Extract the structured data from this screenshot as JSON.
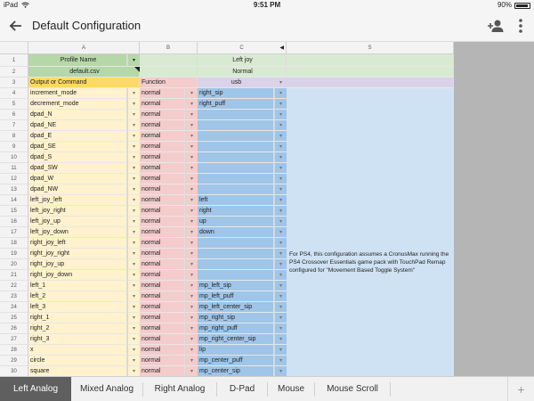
{
  "status_bar": {
    "device": "iPad",
    "time": "9:51 PM",
    "battery": "90%",
    "battery_level": 0.9
  },
  "app_bar": {
    "title": "Default Configuration"
  },
  "columns": [
    {
      "letter": "A"
    },
    {
      "letter": "B"
    },
    {
      "letter": "C",
      "arrow": "◀"
    },
    {
      "letter": "S"
    }
  ],
  "header_rows": {
    "r1": {
      "num": "1",
      "a": "Profile Name",
      "c": "Left joy"
    },
    "r2": {
      "num": "2",
      "a": "default.csv",
      "c": "Normal"
    },
    "r3": {
      "num": "3",
      "a": "Output or Command",
      "b": "Function",
      "c": "usb"
    }
  },
  "rows": [
    {
      "num": "4",
      "a": "increment_mode",
      "b": "normal",
      "c": "right_sip"
    },
    {
      "num": "5",
      "a": "decrement_mode",
      "b": "normal",
      "c": "right_puff"
    },
    {
      "num": "6",
      "a": "dpad_N",
      "b": "normal",
      "c": ""
    },
    {
      "num": "7",
      "a": "dpad_NE",
      "b": "normal",
      "c": ""
    },
    {
      "num": "8",
      "a": "dpad_E",
      "b": "normal",
      "c": ""
    },
    {
      "num": "9",
      "a": "dpad_SE",
      "b": "normal",
      "c": ""
    },
    {
      "num": "10",
      "a": "dpad_S",
      "b": "normal",
      "c": ""
    },
    {
      "num": "11",
      "a": "dpad_SW",
      "b": "normal",
      "c": ""
    },
    {
      "num": "12",
      "a": "dpad_W",
      "b": "normal",
      "c": ""
    },
    {
      "num": "13",
      "a": "dpad_NW",
      "b": "normal",
      "c": ""
    },
    {
      "num": "14",
      "a": "left_joy_left",
      "b": "normal",
      "c": "left"
    },
    {
      "num": "15",
      "a": "left_joy_right",
      "b": "normal",
      "c": "right"
    },
    {
      "num": "16",
      "a": "left_joy_up",
      "b": "normal",
      "c": "up"
    },
    {
      "num": "17",
      "a": "left_joy_down",
      "b": "normal",
      "c": "down"
    },
    {
      "num": "18",
      "a": "right_joy_left",
      "b": "normal",
      "c": ""
    },
    {
      "num": "19",
      "a": "right_joy_right",
      "b": "normal",
      "c": ""
    },
    {
      "num": "20",
      "a": "right_joy_up",
      "b": "normal",
      "c": ""
    },
    {
      "num": "21",
      "a": "right_joy_down",
      "b": "normal",
      "c": ""
    },
    {
      "num": "22",
      "a": "left_1",
      "b": "normal",
      "c": "mp_left_sip"
    },
    {
      "num": "23",
      "a": "left_2",
      "b": "normal",
      "c": "mp_left_puff"
    },
    {
      "num": "24",
      "a": "left_3",
      "b": "normal",
      "c": "mp_left_center_sip"
    },
    {
      "num": "25",
      "a": "right_1",
      "b": "normal",
      "c": "mp_right_sip"
    },
    {
      "num": "26",
      "a": "right_2",
      "b": "normal",
      "c": "mp_right_puff"
    },
    {
      "num": "27",
      "a": "right_3",
      "b": "normal",
      "c": "mp_right_center_sip"
    },
    {
      "num": "28",
      "a": "x",
      "b": "normal",
      "c": "lip"
    },
    {
      "num": "29",
      "a": "circle",
      "b": "normal",
      "c": "mp_center_puff"
    },
    {
      "num": "30",
      "a": "square",
      "b": "normal",
      "c": "mp_center_sip"
    }
  ],
  "note": "For PS4, this configuration assumes a CronusMax running the PS4 Crossover Essentials game pack with TouchPad Remap configured for \"Movement Based Toggle System\"",
  "tabs": [
    {
      "label": "Left Analog",
      "active": true
    },
    {
      "label": "Mixed Analog",
      "active": false
    },
    {
      "label": "Right Analog",
      "active": false
    },
    {
      "label": "D-Pad",
      "active": false
    },
    {
      "label": "Mouse",
      "active": false
    },
    {
      "label": "Mouse Scroll",
      "active": false
    }
  ],
  "add_sheet_label": "+",
  "icons": {
    "back": "arrow-back-icon",
    "add_user": "add-user-icon",
    "more": "more-vertical-icon",
    "dropdown": "dropdown-arrow-icon",
    "note_flag": "comment-flag-icon",
    "wifi": "wifi-icon",
    "battery": "battery-icon"
  },
  "colors": {
    "header_green": "#d9ead3",
    "profile_green": "#b6d7a8",
    "output_yellow": "#fff2cc",
    "function_pink": "#f4cccc",
    "mapping_blue": "#9fc5e8",
    "note_blue": "#cfe2f3",
    "usb_lavender": "#d9d2e9",
    "header_orange": "#ffd966",
    "active_tab": "#5f5f5f"
  }
}
